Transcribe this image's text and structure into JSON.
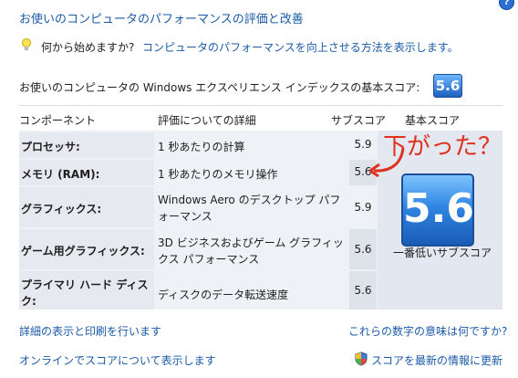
{
  "title": "お使いのコンピュータのパフォーマンスの評価と改善",
  "help_label": "?",
  "tip": {
    "question": "何から始めますか?",
    "link": "コンピュータのパフォーマンスを向上させる方法を表示します。"
  },
  "base_score_label": "お使いのコンピュータの Windows エクスペリエンス インデックスの基本スコア:",
  "base_score": "5.6",
  "table": {
    "headers": {
      "component": "コンポーネント",
      "details": "評価についての詳細",
      "subscore": "サブスコア",
      "basescore": "基本スコア"
    },
    "rows": [
      {
        "component": "プロセッサ:",
        "details": "1 秒あたりの計算",
        "score": "5.9"
      },
      {
        "component": "メモリ (RAM):",
        "details": "1 秒あたりのメモリ操作",
        "score": "5.6"
      },
      {
        "component": "グラフィックス:",
        "details": "Windows Aero のデスクトップ パフォーマンス",
        "score": "5.9"
      },
      {
        "component": "ゲーム用グラフィックス:",
        "details": "3D ビジネスおよびゲーム グラフィックス パフォーマンス",
        "score": "5.6"
      },
      {
        "component": "プライマリ ハード ディスク:",
        "details": "ディスクのデータ転送速度",
        "score": "5.6"
      }
    ],
    "big_score": "5.6",
    "big_score_caption": "一番低いサブスコア"
  },
  "annotation": "下がった？",
  "links": {
    "details_print": "詳細の表示と印刷を行います",
    "what_numbers": "これらの数字の意味は何ですか?",
    "online": "オンラインでスコアについて表示します",
    "refresh": "スコアを最新の情報に更新"
  },
  "colors": {
    "link": "#1a5aa8",
    "annotation": "#e0301e",
    "badge": "#1c5fbf"
  }
}
